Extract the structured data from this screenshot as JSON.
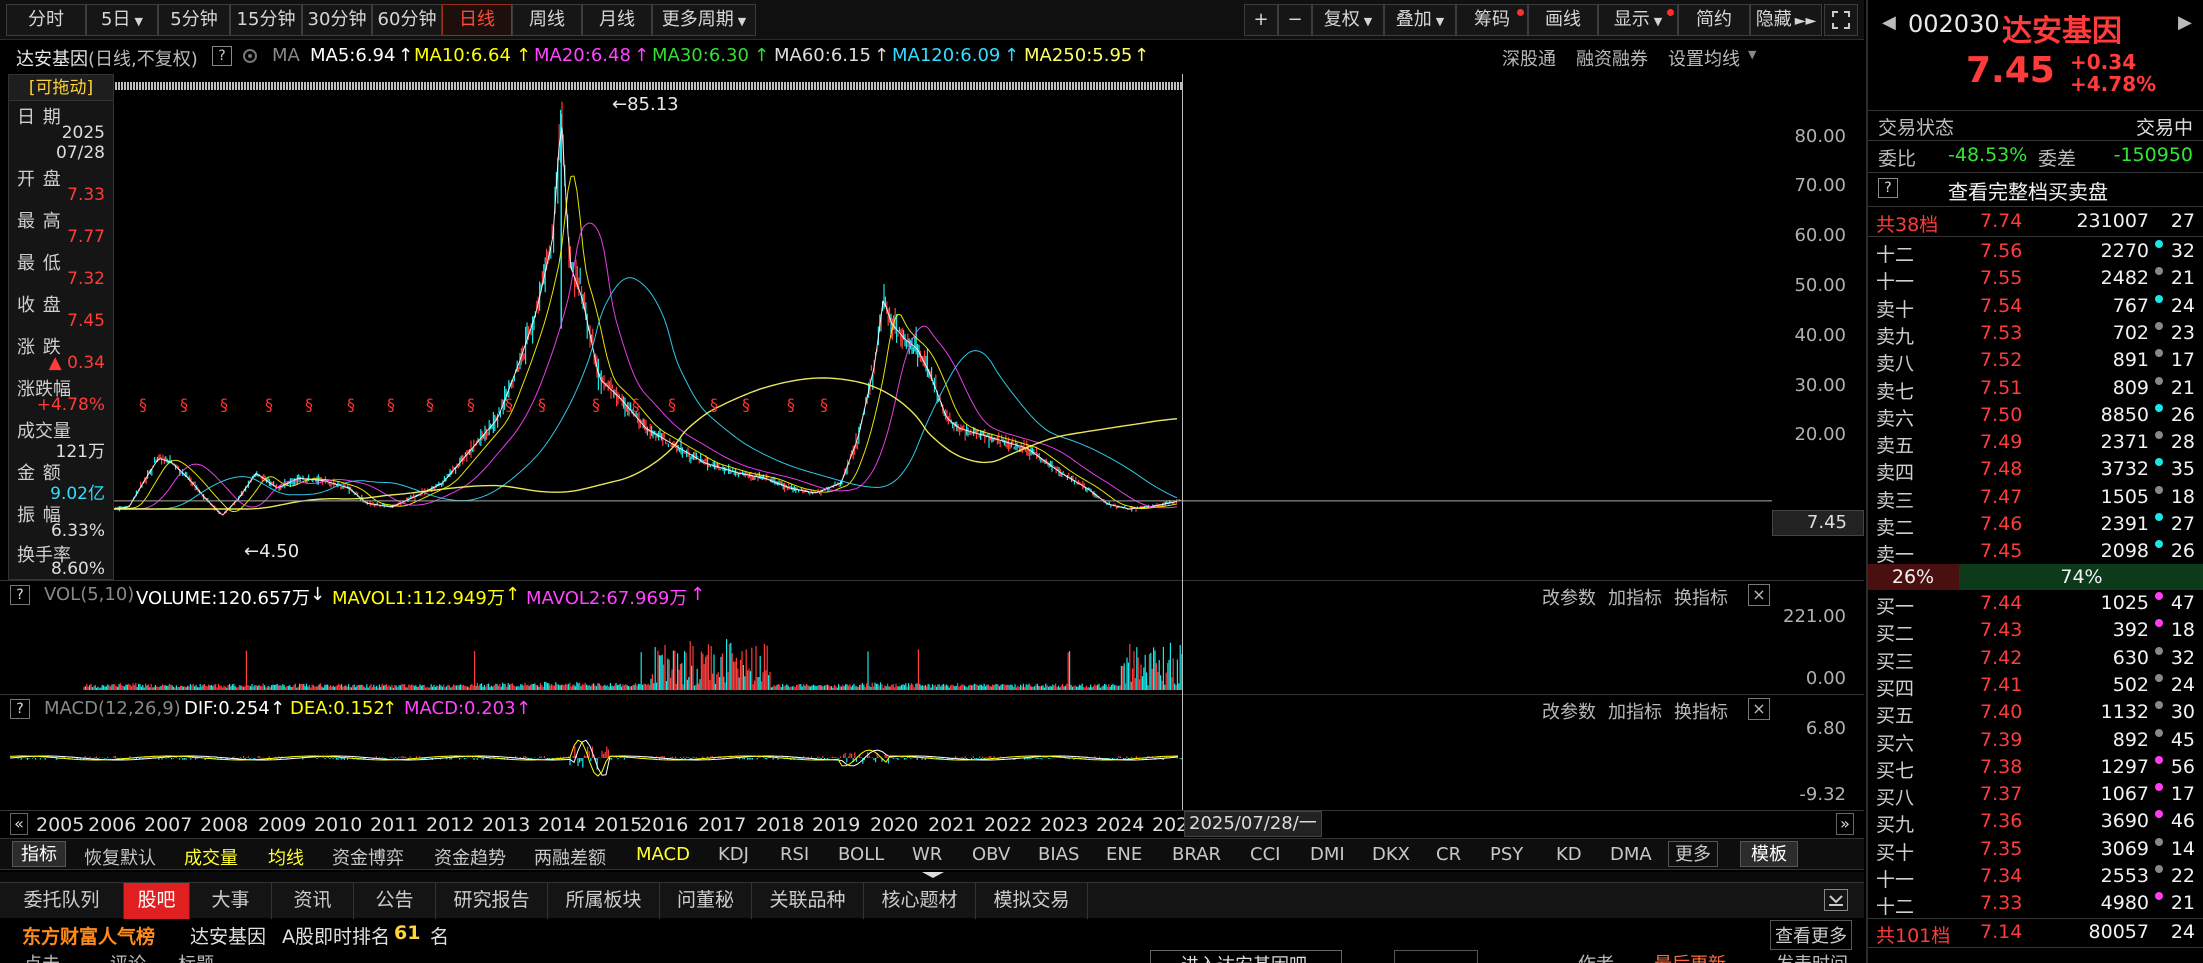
{
  "toolbar": {
    "periods": [
      "分时",
      "5日",
      "5分钟",
      "15分钟",
      "30分钟",
      "60分钟",
      "日线",
      "周线",
      "月线",
      "更多周期"
    ],
    "selected_period": "日线",
    "actions": [
      "+",
      "−",
      "复权",
      "叠加",
      "筹码",
      "画线",
      "显示",
      "简约",
      "隐藏"
    ]
  },
  "ma_row": {
    "stock": "达安基因",
    "mode": "(日线,不复权)",
    "q": "?",
    "ma_label": "MA",
    "ma5": "MA5:6.94",
    "ma10": "MA10:6.64",
    "ma20": "MA20:6.48",
    "ma30": "MA30:6.30",
    "ma60": "MA60:6.15",
    "ma120": "MA120:6.09",
    "ma250": "MA250:5.95",
    "arrow_up": "↑",
    "shentong": "深股通",
    "rzrq": "融资融券",
    "set_ma": "设置均线"
  },
  "data_window": {
    "drag_label": "[可拖动]",
    "date_label": "日 期",
    "date_year": "2025",
    "date_md": "07/28",
    "open_label": "开 盘",
    "open": "7.33",
    "high_label": "最 高",
    "high": "7.77",
    "low_label": "最 低",
    "low": "7.32",
    "close_label": "收 盘",
    "close": "7.45",
    "change_label": "涨 跌",
    "change": "▲ 0.34",
    "pct_label": "涨跌幅",
    "pct": "+4.78%",
    "vol_label": "成交量",
    "vol": "121万",
    "amt_label": "金 额",
    "amt": "9.02亿",
    "amp_label": "振 幅",
    "amp": "6.33%",
    "turn_label": "换手率",
    "turn": "8.60%"
  },
  "price_axis": {
    "ticks": [
      "80.00",
      "70.00",
      "60.00",
      "50.00",
      "40.00",
      "30.00",
      "20.00"
    ],
    "current": "7.45",
    "peak_label": "←85.13",
    "low_label": "←4.50"
  },
  "vol_panel": {
    "q": "?",
    "name": "VOL(5,10)",
    "volume": "VOLUME:120.657万",
    "down_arrow": "↓",
    "mavol1": "MAVOL1:112.949万",
    "mavol2": "MAVOL2:67.969万",
    "up_arrow": "↑",
    "btn_param": "改参数",
    "btn_add": "加指标",
    "btn_switch": "换指标",
    "close": "×",
    "ticks": [
      "221.00",
      "0.00"
    ]
  },
  "macd_panel": {
    "q": "?",
    "name": "MACD(12,26,9)",
    "dif": "DIF:0.254",
    "dea": "DEA:0.152",
    "macd": "MACD:0.203",
    "up_arrow": "↑",
    "btn_param": "改参数",
    "btn_add": "加指标",
    "btn_switch": "换指标",
    "close": "×",
    "ticks": [
      "6.80",
      "-9.32"
    ]
  },
  "year_axis": {
    "years": [
      "2005",
      "2006",
      "2007",
      "2008",
      "2009",
      "2010",
      "2011",
      "2012",
      "2013",
      "2014",
      "2015",
      "2016",
      "2017",
      "2018",
      "2019",
      "2020",
      "2021",
      "2022",
      "2023",
      "2024",
      "202"
    ],
    "cursor_date": "2025/07/28/一",
    "left_arrow": "«",
    "right_arrow": "»"
  },
  "indicator_tabs": [
    "指标",
    "恢复默认",
    "成交量",
    "均线",
    "资金博弈",
    "资金趋势",
    "两融差额",
    "MACD",
    "KDJ",
    "RSI",
    "BOLL",
    "WR",
    "OBV",
    "BIAS",
    "ENE",
    "BRAR",
    "CCI",
    "DMI",
    "DKX",
    "CR",
    "PSY",
    "KD",
    "DMA",
    "更多",
    "模板"
  ],
  "bottom_tabs": [
    "委托队列",
    "股吧",
    "大事",
    "资讯",
    "公告",
    "研究报告",
    "所属板块",
    "问董秘",
    "关联品种",
    "核心题材",
    "模拟交易"
  ],
  "bottom_selected": "股吧",
  "rank_row": {
    "brand": "东方财富人气榜",
    "stock": "达安基因",
    "rank_label": "A股即时排名",
    "rank": "61",
    "unit": "名",
    "more": "查看更多"
  },
  "partial_row": [
    "点击",
    "评论",
    "标题",
    "进入达安基因吧",
    "作者",
    "最后更新",
    "发表时间"
  ],
  "right_panel": {
    "code": "002030",
    "name": "达安基因",
    "price": "7.45",
    "change": "+0.34",
    "pct": "+4.78%",
    "status_label": "交易状态",
    "status": "交易中",
    "weibi_label": "委比",
    "weibi": "-48.53%",
    "weicha_label": "委差",
    "weicha": "-150950",
    "q": "?",
    "view_all": "查看完整档买卖盘",
    "sell_total": {
      "label": "共38档",
      "price": "7.74",
      "vol": "231007",
      "count": "27"
    },
    "asks": [
      {
        "label": "十二",
        "price": "7.56",
        "vol": "2270",
        "count": "32",
        "dot": "#19e6e6"
      },
      {
        "label": "十一",
        "price": "7.55",
        "vol": "2482",
        "count": "21",
        "dot": "#888888"
      },
      {
        "label": "卖十",
        "price": "7.54",
        "vol": "767",
        "count": "24",
        "dot": "#19e6e6"
      },
      {
        "label": "卖九",
        "price": "7.53",
        "vol": "702",
        "count": "23",
        "dot": "#888888"
      },
      {
        "label": "卖八",
        "price": "7.52",
        "vol": "891",
        "count": "17",
        "dot": "#888888"
      },
      {
        "label": "卖七",
        "price": "7.51",
        "vol": "809",
        "count": "21",
        "dot": "#888888"
      },
      {
        "label": "卖六",
        "price": "7.50",
        "vol": "8850",
        "count": "26",
        "dot": "#19e6e6"
      },
      {
        "label": "卖五",
        "price": "7.49",
        "vol": "2371",
        "count": "28",
        "dot": "#888888"
      },
      {
        "label": "卖四",
        "price": "7.48",
        "vol": "3732",
        "count": "35",
        "dot": "#19e6e6"
      },
      {
        "label": "卖三",
        "price": "7.47",
        "vol": "1505",
        "count": "18",
        "dot": "#888888"
      },
      {
        "label": "卖二",
        "price": "7.46",
        "vol": "2391",
        "count": "27",
        "dot": "#19e6e6"
      },
      {
        "label": "卖一",
        "price": "7.45",
        "vol": "2098",
        "count": "26",
        "dot": "#19e6e6"
      }
    ],
    "ratio_sell": "26%",
    "ratio_buy": "74%",
    "ratio_sell_fraction": 0.26,
    "bids": [
      {
        "label": "买一",
        "price": "7.44",
        "vol": "1025",
        "count": "47",
        "dot": "#ff3df0"
      },
      {
        "label": "买二",
        "price": "7.43",
        "vol": "392",
        "count": "18",
        "dot": "#ff3df0"
      },
      {
        "label": "买三",
        "price": "7.42",
        "vol": "630",
        "count": "32",
        "dot": "#888888"
      },
      {
        "label": "买四",
        "price": "7.41",
        "vol": "502",
        "count": "24",
        "dot": "#888888"
      },
      {
        "label": "买五",
        "price": "7.40",
        "vol": "1132",
        "count": "30",
        "dot": "#888888"
      },
      {
        "label": "买六",
        "price": "7.39",
        "vol": "892",
        "count": "45",
        "dot": "#888888"
      },
      {
        "label": "买七",
        "price": "7.38",
        "vol": "1297",
        "count": "56",
        "dot": "#ff3df0"
      },
      {
        "label": "买八",
        "price": "7.37",
        "vol": "1067",
        "count": "17",
        "dot": "#ff3df0"
      },
      {
        "label": "买九",
        "price": "7.36",
        "vol": "3690",
        "count": "46",
        "dot": "#ff3df0"
      },
      {
        "label": "买十",
        "price": "7.35",
        "vol": "3069",
        "count": "14",
        "dot": "#888888"
      },
      {
        "label": "十一",
        "price": "7.34",
        "vol": "2553",
        "count": "22",
        "dot": "#888888"
      },
      {
        "label": "十二",
        "price": "7.33",
        "vol": "4980",
        "count": "21",
        "dot": "#ff3df0"
      }
    ],
    "buy_total": {
      "label": "共101档",
      "price": "7.14",
      "vol": "80057",
      "count": "24"
    }
  },
  "colors": {
    "up": "#ff3b3b",
    "down": "#19e6e6",
    "ma5": "#ffffff",
    "ma10": "#ffff00",
    "ma20": "#ff44ff",
    "ma30": "#33dd33",
    "ma60": "#dddddd",
    "ma120": "#33ddff",
    "ma250": "#ffff66",
    "accent": "#ffd43b"
  }
}
